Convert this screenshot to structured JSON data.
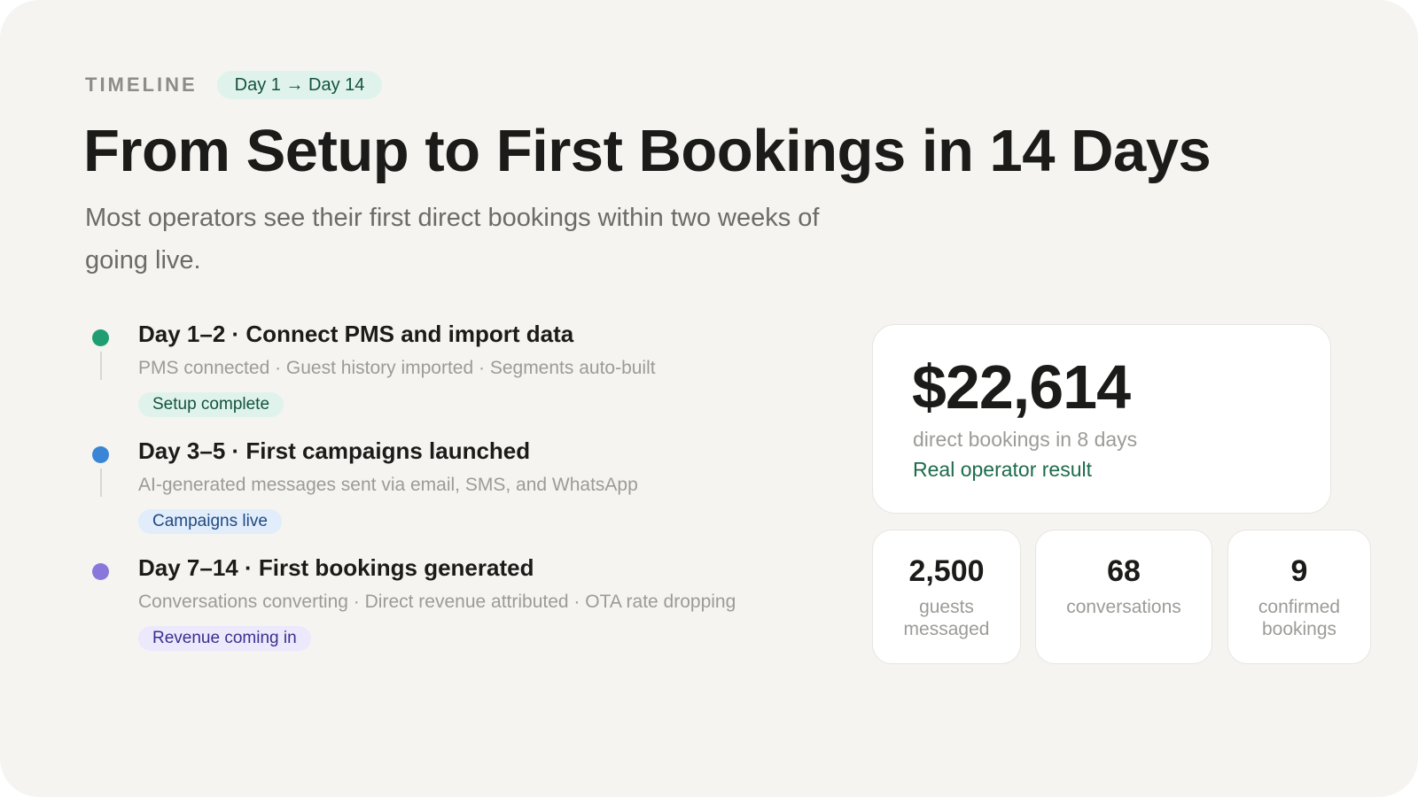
{
  "header": {
    "eyebrow": "TIMELINE",
    "range": "Day 1 → Day 14",
    "title": "From Setup to First Bookings in 14 Days",
    "subtitle": "Most operators see their first direct bookings within two weeks of going live."
  },
  "timeline": {
    "steps": [
      {
        "title": "Day 1–2 · Connect PMS and import data",
        "description": "PMS connected · Guest history imported · Segments auto-built",
        "badge": "Setup complete",
        "dot_color": "#1f9e73"
      },
      {
        "title": "Day 3–5 · First campaigns launched",
        "description": "AI-generated messages sent via email, SMS, and WhatsApp",
        "badge": "Campaigns live",
        "dot_color": "#3b85d6"
      },
      {
        "title": "Day 7–14 · First bookings generated",
        "description": "Conversations converting · Direct revenue attributed · OTA rate dropping",
        "badge": "Revenue coming in",
        "dot_color": "#8878dc"
      }
    ]
  },
  "result": {
    "value": "$22,614",
    "caption": "direct bookings in 8 days",
    "note": "Real operator result"
  },
  "stats": [
    {
      "value": "2,500",
      "label": "guests messaged"
    },
    {
      "value": "68",
      "label": "conversations"
    },
    {
      "value": "9",
      "label": "confirmed bookings"
    }
  ]
}
